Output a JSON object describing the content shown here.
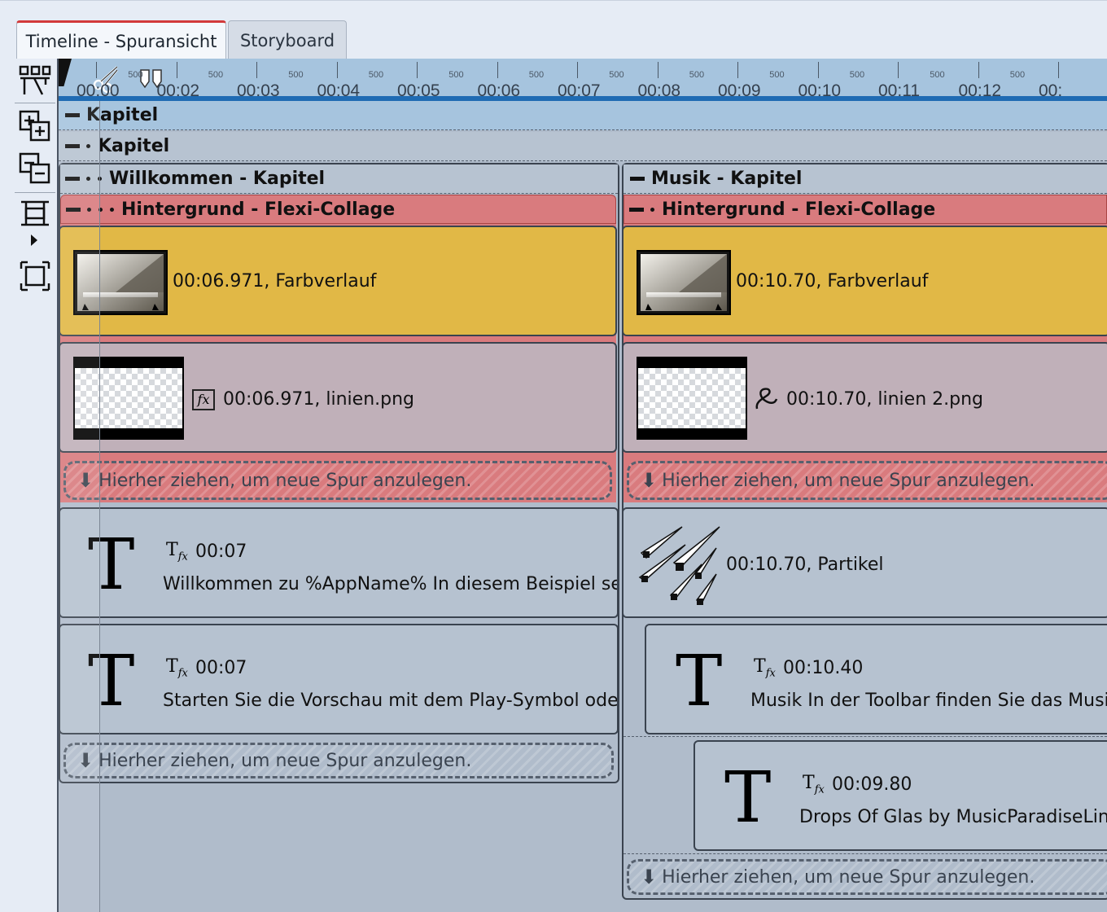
{
  "tabs": {
    "active": "Timeline - Spuransicht",
    "inactive": "Storyboard"
  },
  "toolbar": {
    "items": [
      "split-tracks-icon",
      "add-track-icon",
      "remove-track-icon",
      "fit-timeline-icon",
      "expand-all-icon"
    ]
  },
  "ruler": {
    "labels": [
      "00:00",
      "00:02",
      "00:03",
      "00:04",
      "00:05",
      "00:06",
      "00:07",
      "00:08",
      "00:09",
      "00:10",
      "00:11",
      "00:12",
      "00:"
    ],
    "sub_label": "500"
  },
  "chapters": {
    "root": "Kapitel",
    "sub": "Kapitel",
    "welcome": "Willkommen - Kapitel",
    "music": "Musik - Kapitel",
    "bg_left": "Hintergrund - Flexi-Collage",
    "bg_right": "Hintergrund - Flexi-Collage"
  },
  "clips": {
    "left_gradient": {
      "duration": "00:06.971,",
      "name": "Farbverlauf"
    },
    "right_gradient": {
      "duration": "00:10.70,",
      "name": "Farbverlauf"
    },
    "left_png": {
      "duration": "00:06.971,",
      "name": "linien.png"
    },
    "right_png": {
      "duration": "00:10.70,",
      "name": "linien 2.png"
    },
    "left_text1": {
      "duration": "00:07",
      "text": "Willkommen zu %AppName% In diesem Beispiel sel"
    },
    "left_text2": {
      "duration": "00:07",
      "text": "Starten Sie die Vorschau mit dem Play-Symbol oder"
    },
    "particles": {
      "duration": "00:10.70,",
      "name": "Partikel"
    },
    "right_text1": {
      "duration": "00:10.40",
      "text": "Musik In der Toolbar finden Sie das Musi"
    },
    "right_text2": {
      "duration": "00:09.80",
      "text": "Drops Of Glas by MusicParadiseLin"
    }
  },
  "dropzone": {
    "label": "Hierher ziehen, um neue Spur anzulegen."
  },
  "colors": {
    "accent_tab": "#d23a3a",
    "ruler_bar": "#1f6bb3",
    "flexi_red": "#d97b7e",
    "gradient_clip": "#e1b846",
    "png_clip": "#c0b0b9",
    "text_clip": "#b6c2d0"
  }
}
